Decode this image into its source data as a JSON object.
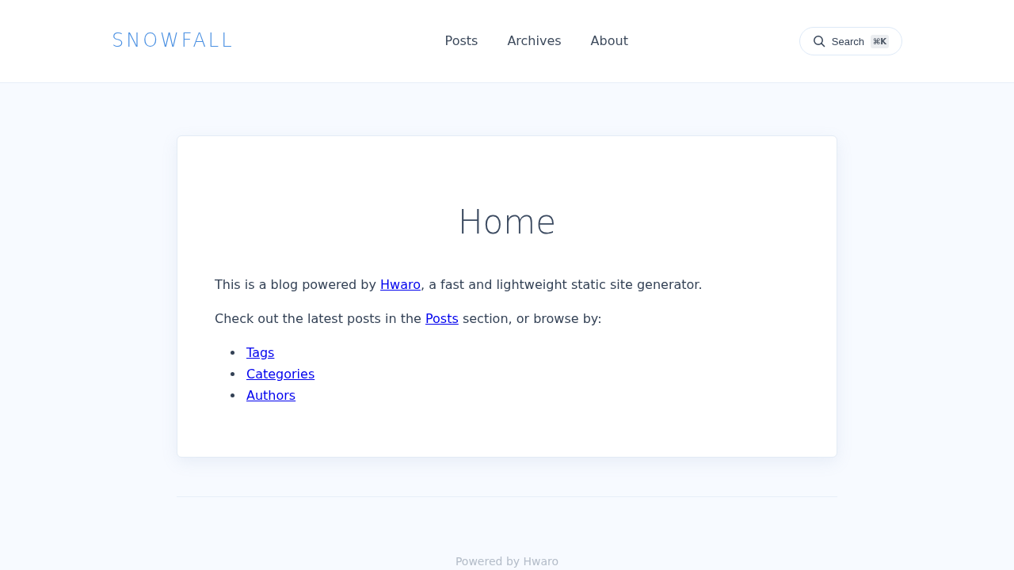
{
  "header": {
    "logo": "SNOWFALL",
    "nav": [
      {
        "label": "Posts"
      },
      {
        "label": "Archives"
      },
      {
        "label": "About"
      }
    ],
    "search": {
      "label": "Search",
      "shortcut": "⌘K"
    }
  },
  "page": {
    "title": "Home",
    "paragraphs": [
      [
        {
          "kind": "text",
          "text": "This is a blog powered by "
        },
        {
          "kind": "link",
          "text": "Hwaro"
        },
        {
          "kind": "text",
          "text": ", a fast and lightweight static site generator."
        }
      ],
      [
        {
          "kind": "text",
          "text": "Check out the latest posts in the "
        },
        {
          "kind": "link",
          "text": "Posts"
        },
        {
          "kind": "text",
          "text": " section, or browse by:"
        }
      ]
    ],
    "list": [
      {
        "label": "Tags"
      },
      {
        "label": "Categories"
      },
      {
        "label": "Authors"
      }
    ]
  },
  "footer": {
    "text": "Powered by Hwaro"
  }
}
